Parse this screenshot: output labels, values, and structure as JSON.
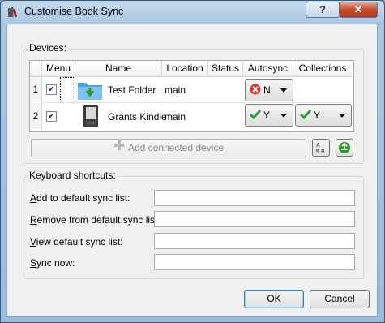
{
  "window": {
    "title": "Customise Book Sync",
    "help_label": "?",
    "close_label": "✕"
  },
  "devices_group": {
    "title": "Devices:"
  },
  "table": {
    "headers": [
      "Menu",
      "Name",
      "Location",
      "Status",
      "Autosync",
      "Collections"
    ],
    "rows": [
      {
        "num": "1",
        "menu_checked": true,
        "icon": "folder-icon",
        "name": "Test Folder",
        "location": "main",
        "status": "",
        "autosync": "N",
        "autosync_icon": "red-x-icon",
        "collections": ""
      },
      {
        "num": "2",
        "menu_checked": true,
        "icon": "kindle-icon",
        "name": "Grants Kindle",
        "location": "main",
        "status": "",
        "autosync": "Y",
        "autosync_icon": "green-check-icon",
        "collections": "Y",
        "collections_icon": "green-check-icon"
      }
    ]
  },
  "add_device_label": "Add connected device",
  "shortcuts_group": {
    "title": "Keyboard shortcuts:"
  },
  "shortcuts": [
    {
      "label": "Add to default sync list:",
      "mnemonic": "A",
      "value": ""
    },
    {
      "label": "Remove from default sync list:",
      "mnemonic": "R",
      "value": ""
    },
    {
      "label": "View default sync list:",
      "mnemonic": "V",
      "value": ""
    },
    {
      "label": "Sync now:",
      "mnemonic": "S",
      "value": ""
    }
  ],
  "ok_label": "OK",
  "cancel_label": "Cancel",
  "colors": {
    "accent_green": "#2f9a2f",
    "error_red": "#d8322b",
    "title_bar": "#a9c6e2"
  }
}
